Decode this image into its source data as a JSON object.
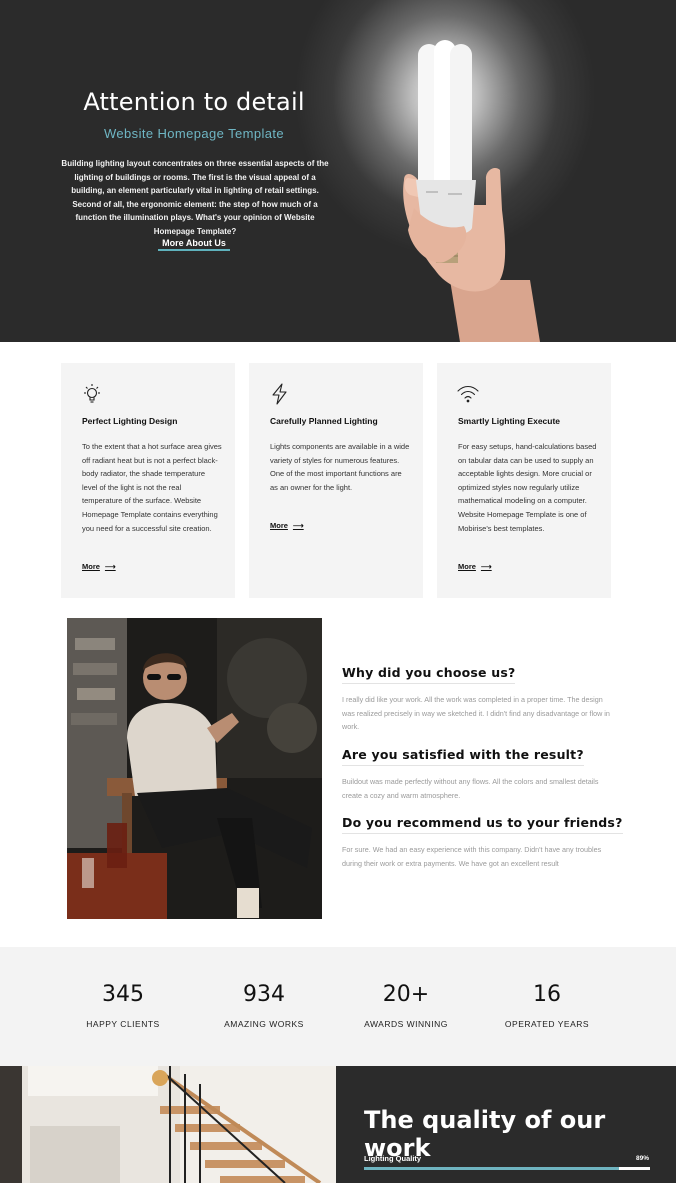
{
  "hero": {
    "title": "Attention to detail",
    "subtitle": "Website Homepage Template",
    "text": "Building lighting layout concentrates on three essential aspects of the lighting of buildings or rooms. The first is the visual appeal of a building, an element particularly vital in lighting of retail settings. Second of all, the ergonomic element: the step of how much of a function the illumination plays. What's your opinion of Website Homepage Template?",
    "link_label": "More About Us",
    "accent_color": "#6fb6c4"
  },
  "features": [
    {
      "icon": "lightbulb-icon",
      "title": "Perfect Lighting Design",
      "text": "To the extent that a hot surface area gives off radiant heat but is not a perfect black-body radiator, the shade temperature level of the light is not the real temperature of the surface. Website Homepage Template contains everything you need for a successful site creation.",
      "more_label": "More"
    },
    {
      "icon": "lightning-icon",
      "title": "Carefully Planned Lighting",
      "text": "Lights components are available in a wide variety of styles for numerous features. One of the most important functions are as an owner for the light.",
      "more_label": "More"
    },
    {
      "icon": "wifi-icon",
      "title": "Smartly Lighting Execute",
      "text": "For easy setups, hand-calculations based on tabular data can be used to supply an acceptable lights design. More crucial or optimized styles now regularly utilize mathematical modeling on a computer. Website Homepage Template is one of Mobirise's best templates.",
      "more_label": "More"
    }
  ],
  "faq": [
    {
      "question": "Why did you choose us?",
      "answer": "I really did like your work. All the work was completed in a proper time. The design was realized precisely in way we sketched it. I didn't find any disadvantage or flow in work."
    },
    {
      "question": "Are you satisfied with the result?",
      "answer": "Buildout was made perfectly without any flows. All the colors and smallest details create a cozy and warm atmosphere."
    },
    {
      "question": "Do you recommend us to your friends?",
      "answer": "For sure. We had an easy experience with this company. Didn't have any troubles during their work or extra payments. We have got an excellent result"
    }
  ],
  "stats": [
    {
      "value": "345",
      "label": "HAPPY CLIENTS"
    },
    {
      "value": "934",
      "label": "AMAZING WORKS"
    },
    {
      "value": "20+",
      "label": "AWARDS WINNING"
    },
    {
      "value": "16",
      "label": "OPERATED YEARS"
    }
  ],
  "quality": {
    "title": "The quality of our work",
    "skill_label": "Lighting Quality",
    "skill_percent_text": "89%",
    "skill_percent": 89,
    "bar_color": "#6fb4c0"
  }
}
